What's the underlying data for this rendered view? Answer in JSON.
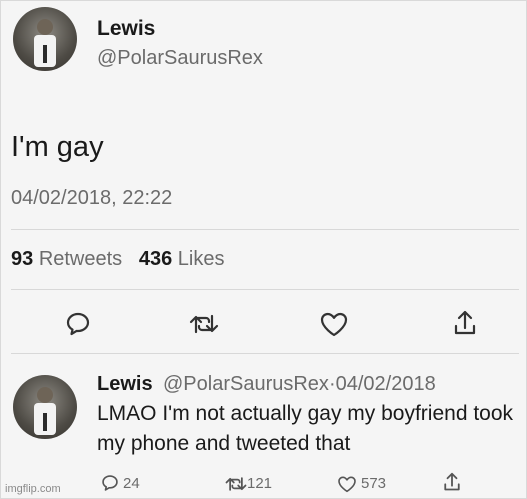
{
  "main_tweet": {
    "author_name": "Lewis",
    "author_handle": "@PolarSaurusRex",
    "text": "I'm gay",
    "timestamp": "04/02/2018, 22:22",
    "retweets_count": "93",
    "retweets_label": "Retweets",
    "likes_count": "436",
    "likes_label": "Likes",
    "actions": [
      "reply-icon",
      "retweet-icon",
      "like-icon",
      "share-icon"
    ]
  },
  "reply_tweet": {
    "author_name": "Lewis",
    "author_handle": "@PolarSaurusRex",
    "separator": "·",
    "date": "04/02/2018",
    "text": "LMAO I'm not actually gay my boyfriend took my phone and tweeted that",
    "reply_count": "24",
    "retweet_count": "121",
    "like_count": "573"
  },
  "watermark": "imgflip.com",
  "colors": {
    "background": "#f5f5f5",
    "text": "#1a1a1a",
    "secondary_text": "#6b6b6b",
    "divider": "#d8d8d8"
  }
}
